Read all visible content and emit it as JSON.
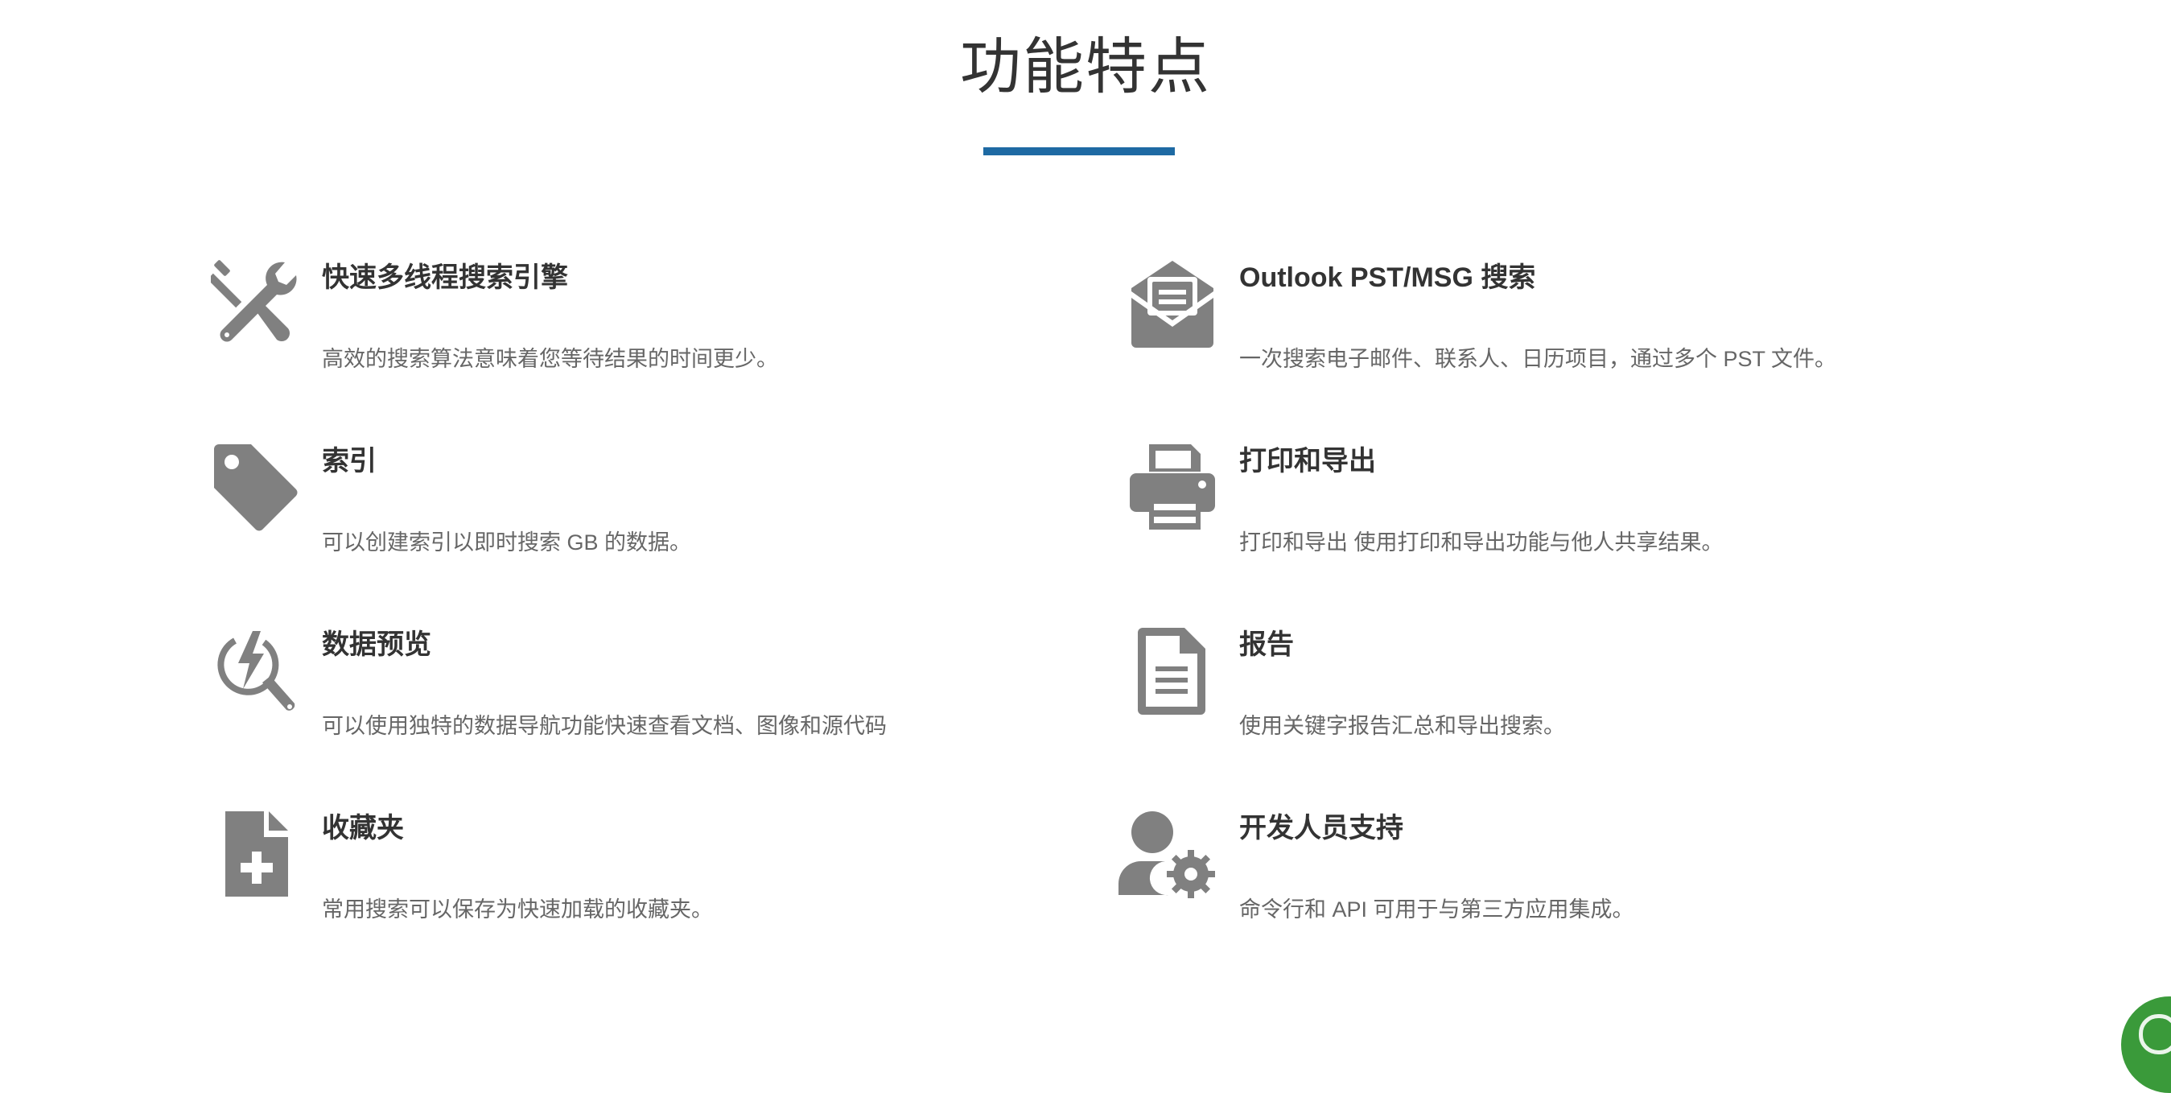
{
  "section": {
    "title": "功能特点"
  },
  "colors": {
    "accent": "#1e6aa3",
    "icon": "#808080",
    "chat": "#3a9a3a"
  },
  "features": [
    {
      "icon": "tools-icon",
      "title": "快速多线程搜索引擎",
      "desc": "高效的搜索算法意味着您等待结果的时间更少。"
    },
    {
      "icon": "open-envelope-icon",
      "title": "Outlook PST/MSG 搜索",
      "desc": "一次搜索电子邮件、联系人、日历项目，通过多个 PST 文件。"
    },
    {
      "icon": "tag-icon",
      "title": "索引",
      "desc": "可以创建索引以即时搜索 GB 的数据。"
    },
    {
      "icon": "printer-icon",
      "title": "打印和导出",
      "desc": "打印和导出 使用打印和导出功能与他人共享结果。"
    },
    {
      "icon": "quick-preview-icon",
      "title": "数据预览",
      "desc": "可以使用独特的数据导航功能快速查看文档、图像和源代码"
    },
    {
      "icon": "document-icon",
      "title": "报告",
      "desc": "使用关键字报告汇总和导出搜索。"
    },
    {
      "icon": "file-plus-icon",
      "title": "收藏夹",
      "desc": "常用搜索可以保存为快速加载的收藏夹。"
    },
    {
      "icon": "user-gear-icon",
      "title": "开发人员支持",
      "desc": "命令行和 API 可用于与第三方应用集成。"
    }
  ]
}
